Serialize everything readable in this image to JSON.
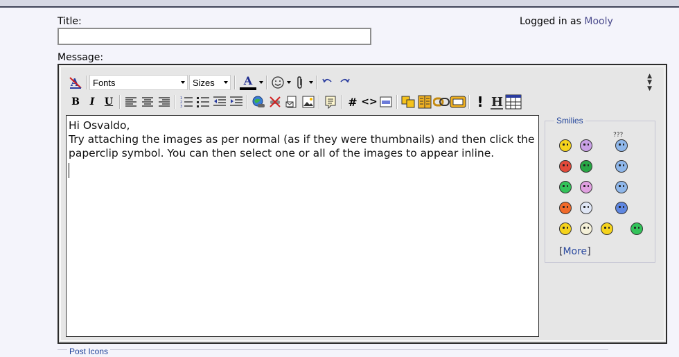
{
  "header": {
    "logged_in_prefix": "Logged in as",
    "username": "Mooly"
  },
  "form": {
    "title_label": "Title:",
    "title_value": "",
    "message_label": "Message:"
  },
  "toolbar": {
    "fonts_label": "Fonts",
    "sizes_label": "Sizes",
    "bold": "B",
    "italic": "I",
    "underline": "U",
    "font_color_letter": "A",
    "code_hash": "#",
    "html_code": "<>"
  },
  "message": {
    "lines": [
      "Hi Osvaldo,",
      "",
      "Try attaching the images as per normal (as if they were thumbnails) and then click the paperclip symbol. You can then select one or all of the images to appear inline."
    ]
  },
  "smilies": {
    "legend": "Smilies",
    "confused_text": "???",
    "more_open": "[",
    "more_label": "More",
    "more_close": "]"
  },
  "post_icons": {
    "legend": "Post Icons"
  },
  "colors": {
    "accent": "#22449a",
    "smiley_yellow": "#f5d31c",
    "smiley_purple": "#c9a0e6",
    "smiley_blue": "#8fb7ea",
    "smiley_red": "#e24a3a",
    "smiley_green": "#28a745"
  }
}
